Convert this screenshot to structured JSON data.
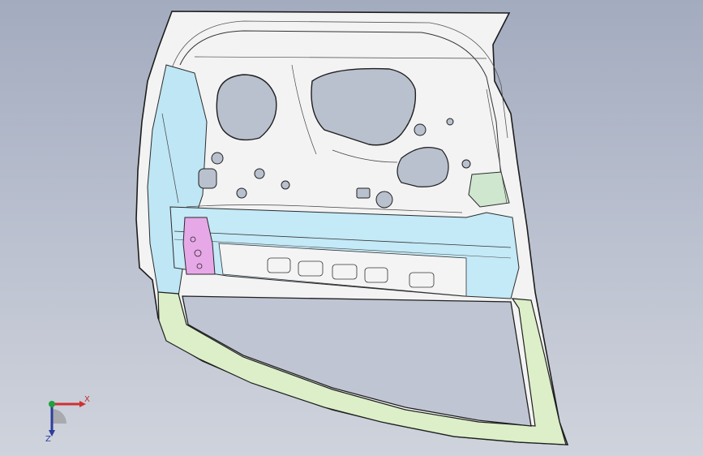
{
  "viewport": {
    "background_top": "#a3abbf",
    "background_bottom": "#cfd3dc"
  },
  "model": {
    "part": "car-door-inner-panel",
    "colors": {
      "panel": "#f2f2f2",
      "edge": "#222222",
      "reinforcement": "#bfe6f5",
      "lower_frame": "#dcefc8",
      "bracket_pink": "#e7a8e7",
      "bracket_green": "#cfe6cf"
    }
  },
  "triad": {
    "x_label": "X",
    "z_label": "Z",
    "x_color": "#d03030",
    "y_color": "#20a040",
    "z_color": "#2c3e9a"
  }
}
